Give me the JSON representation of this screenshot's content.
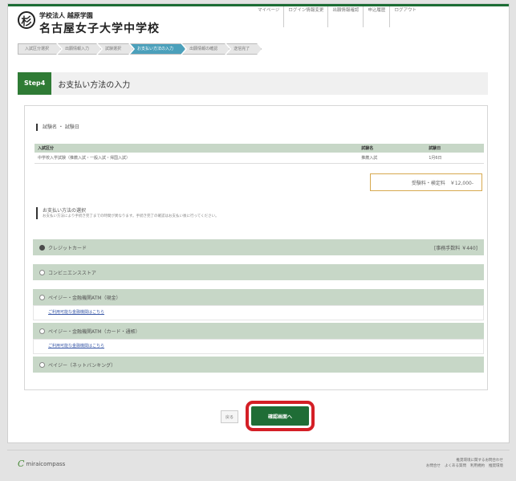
{
  "header": {
    "logo_kanji": "杉",
    "school_sub": "学校法人 越原学園",
    "school_name": "名古屋女子大学中学校",
    "nav": [
      "マイページ",
      "ログイン情報変更",
      "出願情報確認",
      "申込履歴",
      "ログアウト"
    ]
  },
  "steps": [
    "入試区分選択",
    "出願情報入力",
    "試験選択",
    "お支払い方法の入力",
    "出願情報の確認",
    "送信完了"
  ],
  "step_header": {
    "badge": "Step4",
    "title": "お支払い方法の入力"
  },
  "applicant": {
    "label": "試験名 ・ 試験日"
  },
  "exam_table": {
    "headers": [
      "入試区分",
      "試験名",
      "試験日"
    ],
    "rows": [
      [
        "中学校入学試験（推薦入試・一般入試・帰国入試）",
        "推薦入試",
        "1月6日"
      ]
    ]
  },
  "total": {
    "label": "受験料・検定料",
    "amount": "￥12,000-"
  },
  "payment": {
    "label": "お支払い方法の選択",
    "note": "お支払い方法により手続き完了までの時間が異なります。手続き完了の確認はお支払い後に行ってください。",
    "options": [
      {
        "label": "クレジットカード",
        "selected": true,
        "fee": "[事務手数料 ￥440]"
      },
      {
        "label": "コンビニエンスストア",
        "selected": false,
        "fee": ""
      },
      {
        "label": "ペイジー・金融機関ATM（現金）",
        "selected": false,
        "fee": "",
        "link": "ご利用可能な金融機関はこちら"
      },
      {
        "label": "ペイジー・金融機関ATM（カード・通帳）",
        "selected": false,
        "fee": "",
        "link": "ご利用可能な金融機関はこちら"
      },
      {
        "label": "ペイジー（ネットバンキング）",
        "selected": false,
        "fee": ""
      }
    ]
  },
  "buttons": {
    "back": "戻る",
    "next": "確認画面へ"
  },
  "footer": {
    "brand": "miraicompass",
    "mark": "C",
    "links_top": [
      "推奨環境に関するお問合わせ"
    ],
    "links_bottom": [
      "お問合せ",
      "よくある質問",
      "利用規約",
      "推奨環境"
    ]
  }
}
